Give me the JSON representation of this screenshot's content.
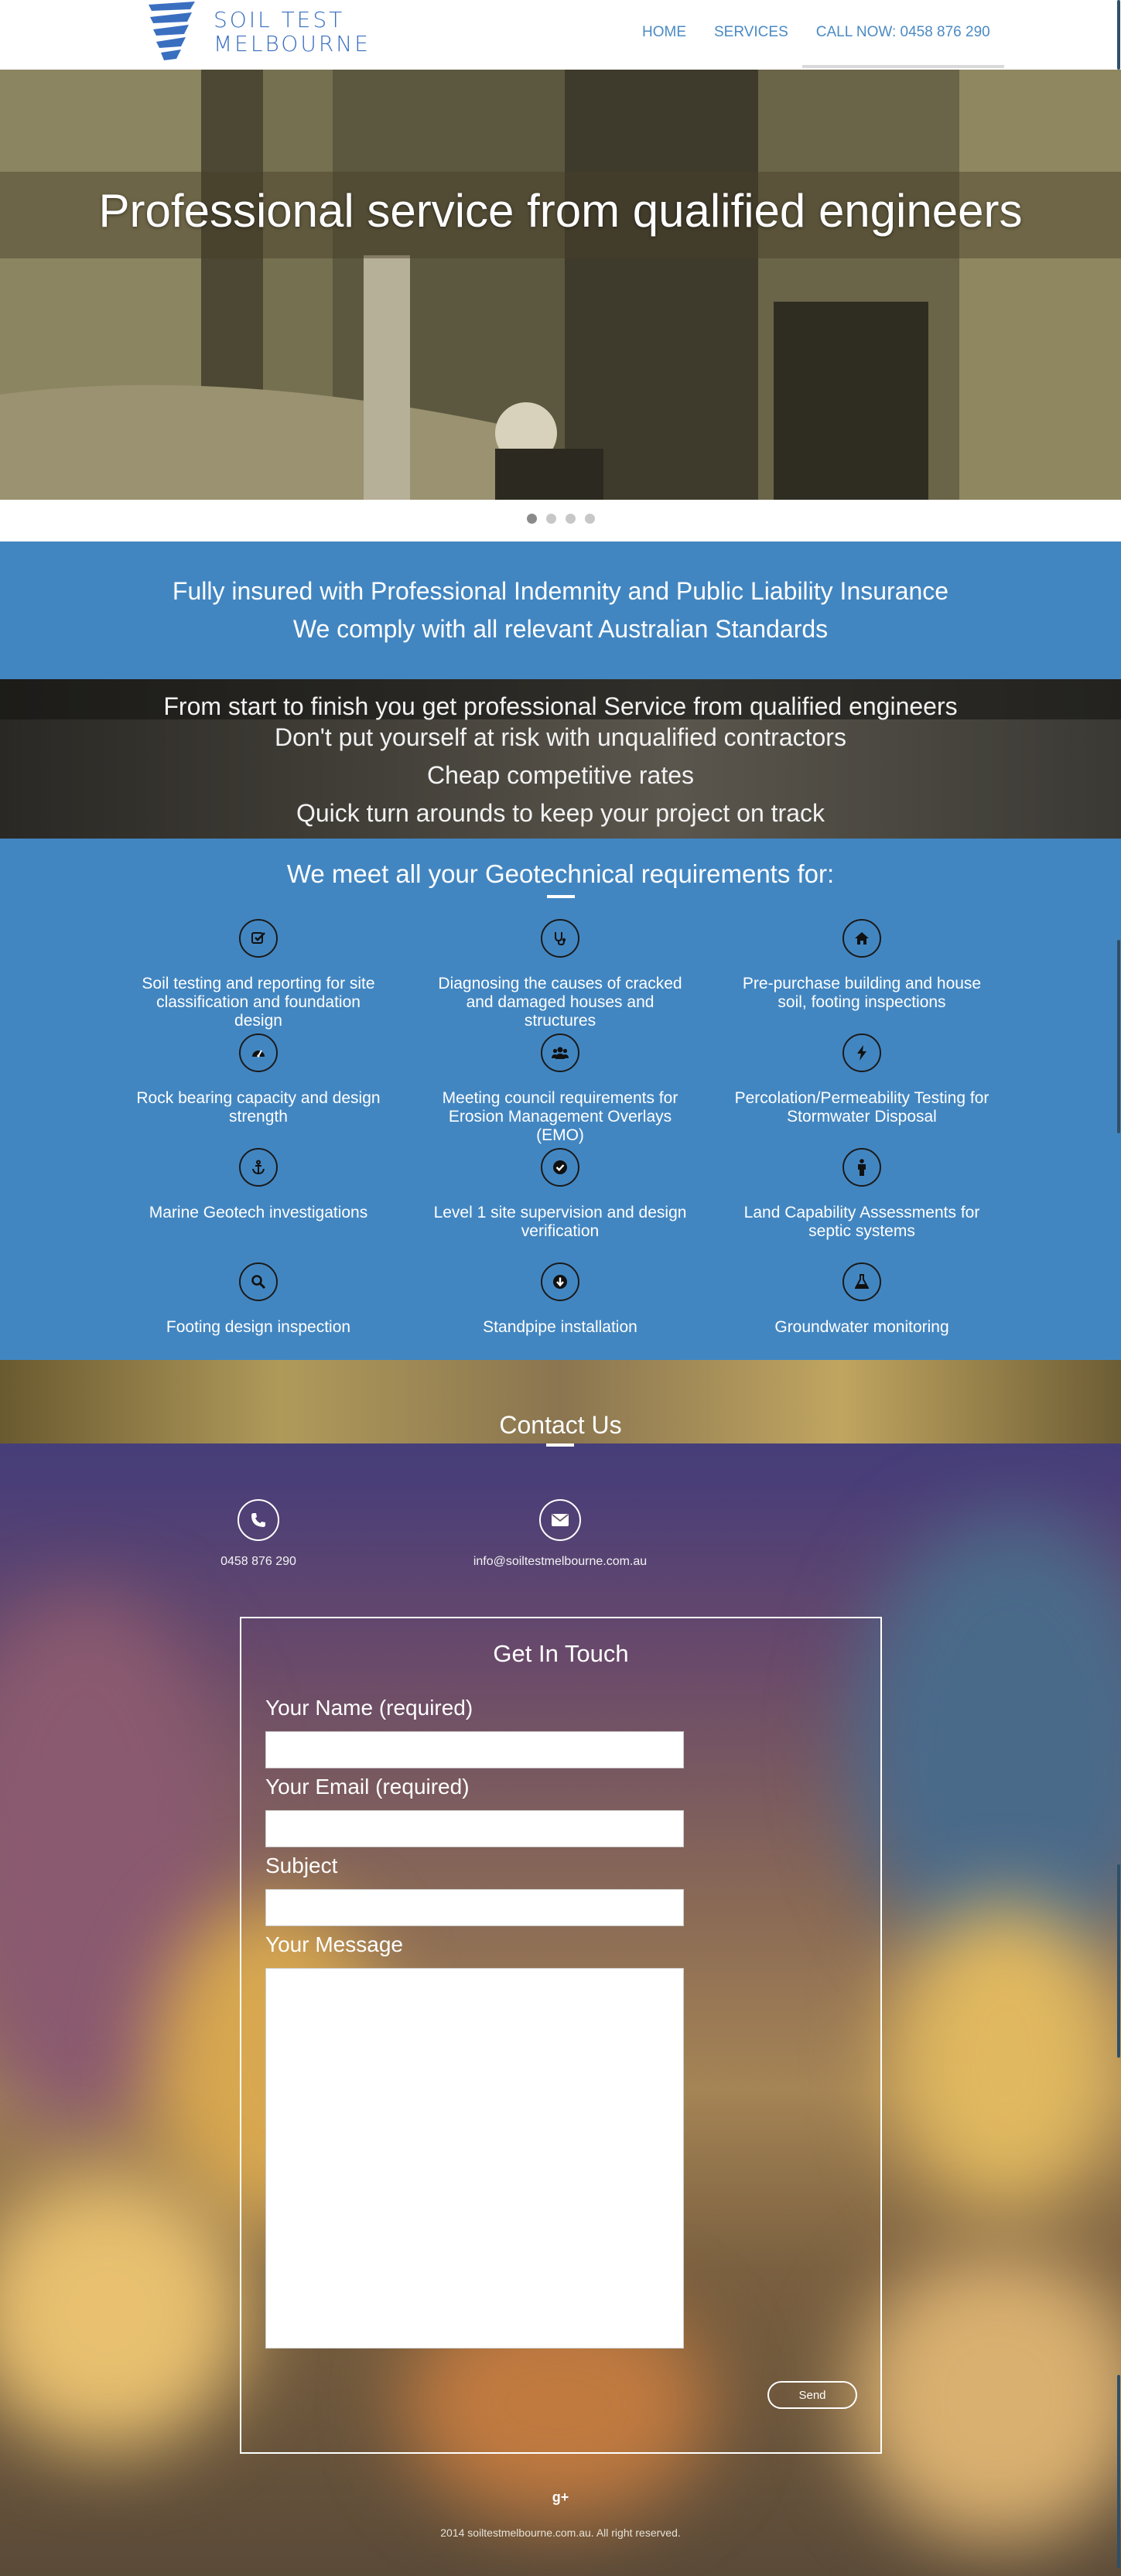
{
  "brand": {
    "line1": "SOIL TEST",
    "line2": "MELBOURNE",
    "accent": "#3a6fc0"
  },
  "nav": {
    "items": [
      {
        "label": "HOME"
      },
      {
        "label": "SERVICES"
      },
      {
        "label": "CALL NOW: 0458 876 290"
      }
    ]
  },
  "hero": {
    "title": "Professional service from qualified engineers",
    "slide_count": 4,
    "active_slide": 1
  },
  "insured": {
    "line1": "Fully insured with Professional Indemnity and Public Liability Insurance",
    "line2": "We comply with all relevant Australian Standards"
  },
  "benefits": {
    "line1": "From start to finish you get professional Service from qualified engineers",
    "line2": "Don't put yourself at risk with unqualified contractors",
    "line3": "Cheap competitive rates",
    "line4": "Quick turn arounds to keep your project on track"
  },
  "services": {
    "heading": "We meet all your Geotechnical requirements for:",
    "background": "#4286c1",
    "items": [
      {
        "icon": "checkbox-icon",
        "label": "Soil testing and reporting for site classification and foundation design"
      },
      {
        "icon": "stethoscope-icon",
        "label": "Diagnosing the causes of cracked and damaged houses and structures"
      },
      {
        "icon": "home-icon",
        "label": "Pre-purchase building and house soil, footing inspections"
      },
      {
        "icon": "dashboard-icon",
        "label": "Rock bearing capacity and design strength"
      },
      {
        "icon": "users-icon",
        "label": "Meeting council requirements for Erosion Management Overlays (EMO)"
      },
      {
        "icon": "bolt-icon",
        "label": "Percolation/Permeability Testing for Stormwater Disposal"
      },
      {
        "icon": "anchor-icon",
        "label": "Marine Geotech investigations"
      },
      {
        "icon": "check-circle-icon",
        "label": "Level 1 site supervision and design verification"
      },
      {
        "icon": "male-icon",
        "label": "Land Capability Assessments for septic systems"
      },
      {
        "icon": "search-icon",
        "label": "Footing design inspection"
      },
      {
        "icon": "arrow-down-icon",
        "label": "Standpipe installation"
      },
      {
        "icon": "flask-icon",
        "label": "Groundwater monitoring"
      }
    ]
  },
  "contact": {
    "heading": "Contact Us",
    "phone": "0458 876 290",
    "email": "info@soiltestmelbourne.com.au"
  },
  "form": {
    "title": "Get In Touch",
    "name_label": "Your Name (required)",
    "email_label": "Your Email (required)",
    "subject_label": "Subject",
    "message_label": "Your Message",
    "send_label": "Send"
  },
  "footer": {
    "gplus": "g+",
    "copyright": "2014 soiltestmelbourne.com.au. All right reserved."
  }
}
